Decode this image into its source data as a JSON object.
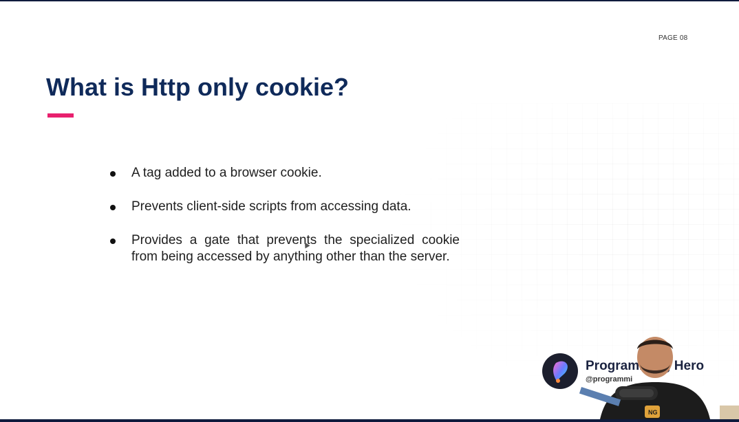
{
  "slide": {
    "page_label": "PAGE 08",
    "title": "What is Http only cookie?",
    "accent_color": "#e8206e",
    "title_color": "#0f2a5a",
    "bullets": [
      "A tag added to a browser cookie.",
      "Prevents client-side scripts from accessing data.",
      "Provides a gate that prevents the specialized cookie from being accessed by anything other than the server."
    ]
  },
  "overlay": {
    "brand_name": "Programming Hero",
    "brand_handle": "@programmi"
  }
}
